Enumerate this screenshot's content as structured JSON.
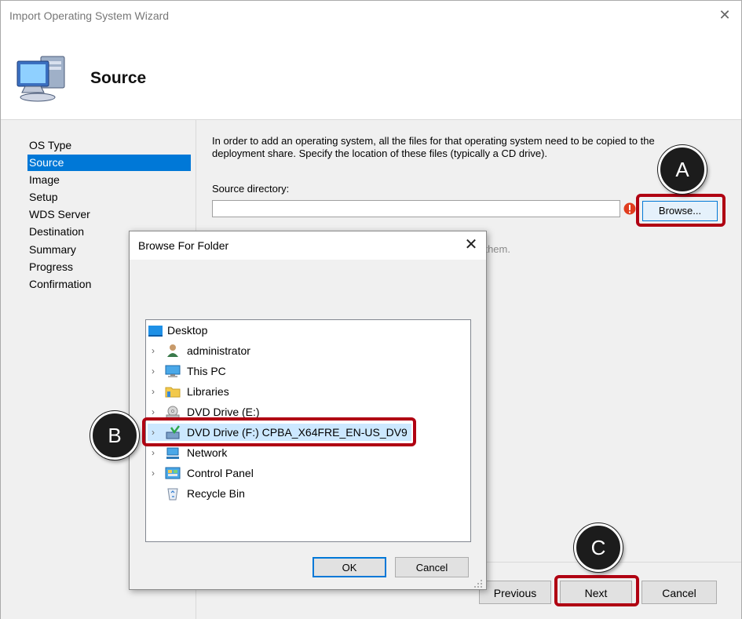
{
  "wizard": {
    "title": "Import Operating System Wizard",
    "close_glyph": "✕",
    "page_heading": "Source"
  },
  "nav": {
    "items": [
      {
        "label": "OS Type",
        "selected": false
      },
      {
        "label": "Source",
        "selected": true
      },
      {
        "label": "Image",
        "selected": false
      },
      {
        "label": "Setup",
        "selected": false
      },
      {
        "label": "WDS Server",
        "selected": false
      },
      {
        "label": "Destination",
        "selected": false
      },
      {
        "label": "Summary",
        "selected": false
      },
      {
        "label": "Progress",
        "selected": false
      },
      {
        "label": "Confirmation",
        "selected": false
      }
    ]
  },
  "source": {
    "instructions": "In order to add an operating system, all the files for that operating system need to be copied to the deployment share.  Specify the location of these files (typically a CD drive).",
    "directory_label": "Source directory:",
    "directory_value": "",
    "browse_label": "Browse...",
    "hint_fragment": "ying them."
  },
  "footer": {
    "previous_label": "Previous",
    "next_label": "Next",
    "cancel_label": "Cancel"
  },
  "dialog": {
    "title": "Browse For Folder",
    "close_glyph": "✕",
    "tree": [
      {
        "label": "Desktop",
        "icon": "desktop-icon",
        "expandable": false
      },
      {
        "label": "administrator",
        "icon": "user-icon",
        "expandable": true
      },
      {
        "label": "This PC",
        "icon": "monitor-icon",
        "expandable": true
      },
      {
        "label": "Libraries",
        "icon": "folder-icon",
        "expandable": true
      },
      {
        "label": "DVD Drive (E:)",
        "icon": "dvd-drive-icon",
        "expandable": true
      },
      {
        "label": "DVD Drive (F:) CPBA_X64FRE_EN-US_DV9",
        "icon": "dvd-disc-icon",
        "expandable": true,
        "selected": true
      },
      {
        "label": "Network",
        "icon": "network-icon",
        "expandable": true
      },
      {
        "label": "Control Panel",
        "icon": "control-panel-icon",
        "expandable": true
      },
      {
        "label": "Recycle Bin",
        "icon": "recycle-bin-icon",
        "expandable": false
      }
    ],
    "ok_label": "OK",
    "cancel_label": "Cancel",
    "chevron_glyph": "›"
  },
  "annotations": {
    "a": "A",
    "b": "B",
    "c": "C",
    "highlight_color": "#b00012"
  },
  "colors": {
    "selection": "#0078d7",
    "tree_selection": "#cce8ff"
  }
}
